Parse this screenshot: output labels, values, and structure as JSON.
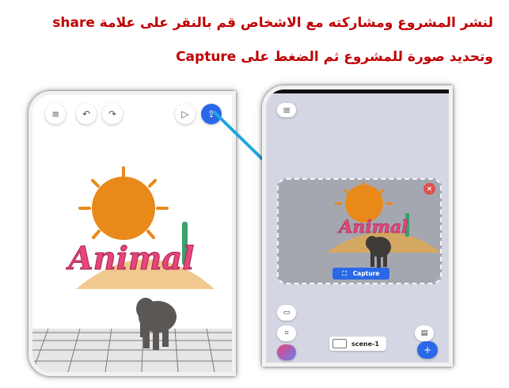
{
  "instructions": {
    "line1": "لنشر المشروع ومشاركته مع الاشخاص قم بالنقر على علامة share",
    "line2": "وتحديد صورة للمشروع ثم الضغط على Capture"
  },
  "scene": {
    "title_text": "Animal"
  },
  "editor_toolbar": {
    "menu_icon": "menu-icon",
    "undo_icon": "undo-icon",
    "redo_icon": "redo-icon",
    "play_icon": "play-icon",
    "share_icon": "share-icon"
  },
  "capture_panel": {
    "capture_label": "Capture",
    "close_label": "×"
  },
  "scene_bar": {
    "scene_name": "scene-1",
    "add_label": "+"
  },
  "colors": {
    "heading": "#c00000",
    "accent_blue": "#2b68e8",
    "arrow": "#1fa5e0",
    "sun": "#e8891a",
    "title_pink": "#e8457a"
  }
}
